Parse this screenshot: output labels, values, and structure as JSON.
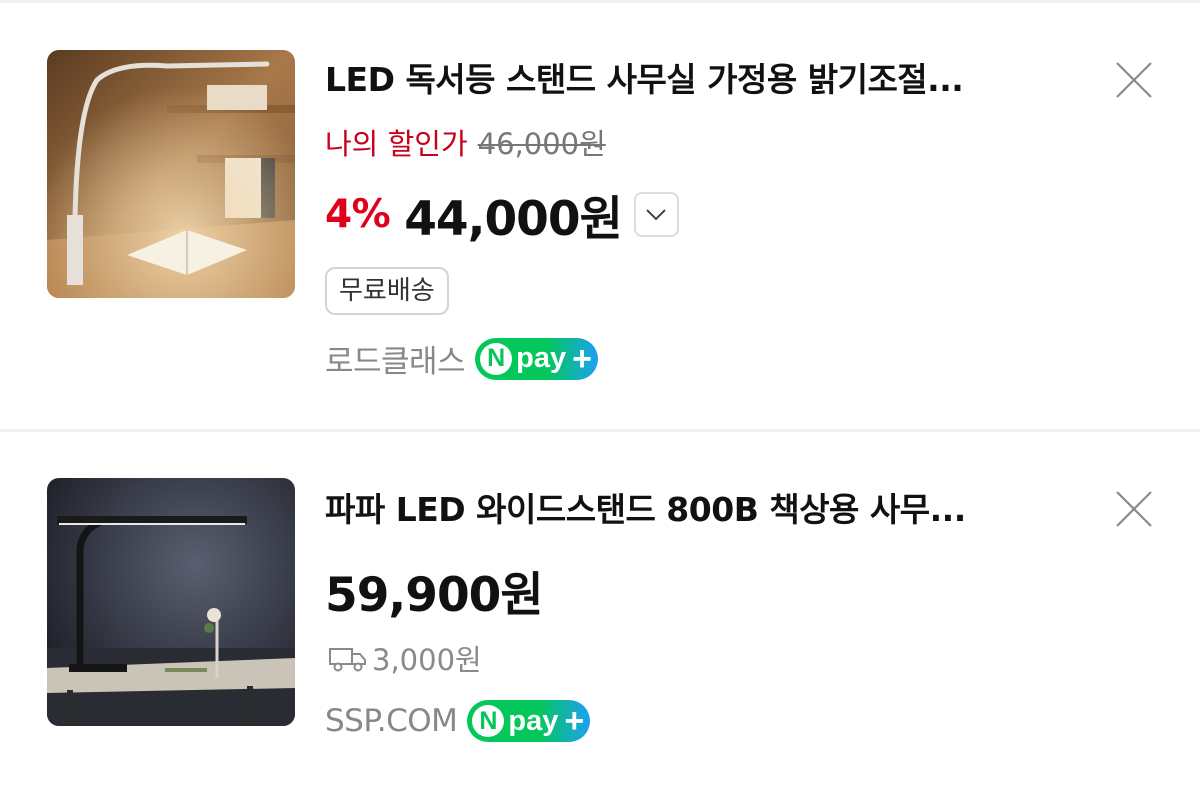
{
  "products": [
    {
      "title": "LED 독서등 스탠드 사무실 가정용 밝기조절...",
      "my_price_label": "나의 할인가",
      "original_price": "46,000원",
      "discount": "4%",
      "price": "44,000원",
      "badge": "무료배송",
      "seller": "로드클래스",
      "close_icon": "close-icon",
      "image": "led-reading-lamp-on-desk"
    },
    {
      "title": "파파 LED 와이드스탠드 800B 책상용 사무...",
      "price": "59,900원",
      "shipping_fee": "3,000원",
      "seller": "SSP.COM",
      "close_icon": "close-icon",
      "image": "wide-led-desk-lamp-dark-room"
    }
  ],
  "npay": {
    "n": "N",
    "label": "pay",
    "plus": "+"
  },
  "colors": {
    "discount_red": "#e0001a",
    "my_price_red": "#c7001c",
    "npay_green": "#03c75a",
    "npay_blue": "#1da1f2"
  }
}
